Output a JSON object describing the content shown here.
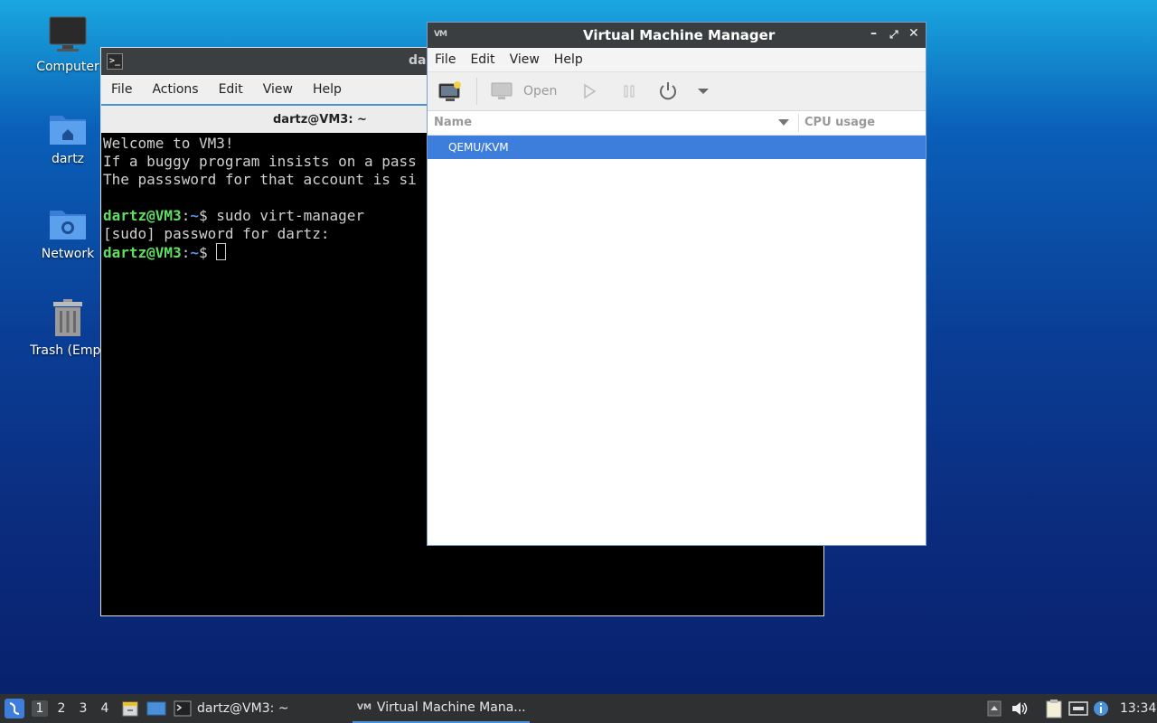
{
  "desktop": {
    "icons": [
      {
        "label": "Computer"
      },
      {
        "label": "dartz"
      },
      {
        "label": "Network"
      },
      {
        "label": "Trash (Empt"
      }
    ]
  },
  "terminal": {
    "title": "da",
    "menu": [
      "File",
      "Actions",
      "Edit",
      "View",
      "Help"
    ],
    "tab_title": "dartz@VM3: ~",
    "lines": {
      "l1": "Welcome to VM3!",
      "l2": "If a buggy program insists on a pass",
      "l3": "The passsword for that account is si",
      "l5_user": "dartz@VM3",
      "l5_sep": ":",
      "l5_path": "~",
      "l5_cmd": "$ sudo virt-manager",
      "l6": "[sudo] password for dartz:",
      "l7_user": "dartz@VM3",
      "l7_sep": ":",
      "l7_path": "~",
      "l7_cmd": "$ "
    }
  },
  "vmm": {
    "title": "Virtual Machine Manager",
    "menu": [
      "File",
      "Edit",
      "View",
      "Help"
    ],
    "toolbar": {
      "open_label": "Open"
    },
    "columns": {
      "name": "Name",
      "cpu": "CPU usage"
    },
    "rows": [
      {
        "name": "QEMU/KVM"
      }
    ]
  },
  "taskbar": {
    "workspaces": [
      "1",
      "2",
      "3",
      "4"
    ],
    "tasks": [
      {
        "label": "dartz@VM3: ~"
      },
      {
        "label": "Virtual Machine Mana..."
      }
    ],
    "clock": "13:34"
  },
  "colors": {
    "accent": "#4a90d9",
    "selection": "#3d7ddb",
    "prompt_user": "#5fdf5f",
    "prompt_path": "#5a8fe8"
  }
}
